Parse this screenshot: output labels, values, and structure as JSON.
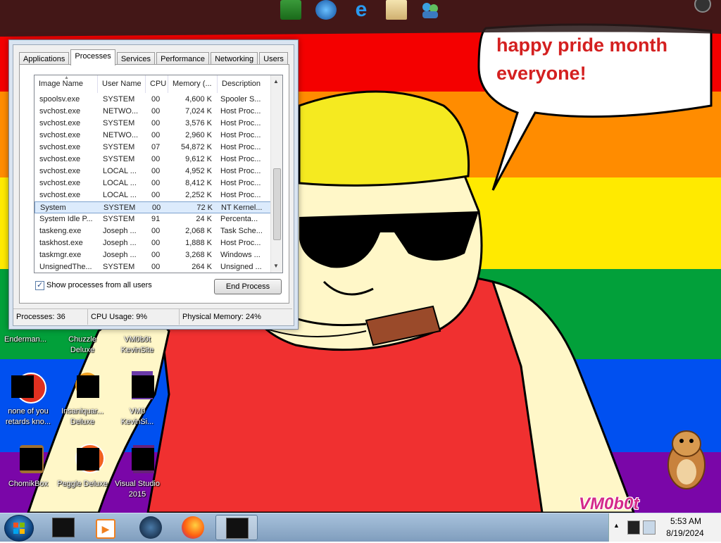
{
  "speech_bubble": {
    "line1": "happy pride month",
    "line2": "everyone!"
  },
  "watermark": "VM0b0t",
  "task_manager": {
    "tabs": [
      "Applications",
      "Processes",
      "Services",
      "Performance",
      "Networking",
      "Users"
    ],
    "active_tab": "Processes",
    "columns": [
      "Image Name",
      "User Name",
      "CPU",
      "Memory (...",
      "Description"
    ],
    "rows": [
      {
        "image": "spoolsv.exe",
        "user": "SYSTEM",
        "cpu": "00",
        "mem": "4,600 K",
        "desc": "Spooler S..."
      },
      {
        "image": "svchost.exe",
        "user": "NETWO...",
        "cpu": "00",
        "mem": "7,024 K",
        "desc": "Host Proc..."
      },
      {
        "image": "svchost.exe",
        "user": "SYSTEM",
        "cpu": "00",
        "mem": "3,576 K",
        "desc": "Host Proc..."
      },
      {
        "image": "svchost.exe",
        "user": "NETWO...",
        "cpu": "00",
        "mem": "2,960 K",
        "desc": "Host Proc..."
      },
      {
        "image": "svchost.exe",
        "user": "SYSTEM",
        "cpu": "07",
        "mem": "54,872 K",
        "desc": "Host Proc..."
      },
      {
        "image": "svchost.exe",
        "user": "SYSTEM",
        "cpu": "00",
        "mem": "9,612 K",
        "desc": "Host Proc..."
      },
      {
        "image": "svchost.exe",
        "user": "LOCAL ...",
        "cpu": "00",
        "mem": "4,952 K",
        "desc": "Host Proc..."
      },
      {
        "image": "svchost.exe",
        "user": "LOCAL ...",
        "cpu": "00",
        "mem": "8,412 K",
        "desc": "Host Proc..."
      },
      {
        "image": "svchost.exe",
        "user": "LOCAL ...",
        "cpu": "00",
        "mem": "2,252 K",
        "desc": "Host Proc..."
      },
      {
        "image": "System",
        "user": "SYSTEM",
        "cpu": "00",
        "mem": "72 K",
        "desc": "NT Kernel..."
      },
      {
        "image": "System Idle P...",
        "user": "SYSTEM",
        "cpu": "91",
        "mem": "24 K",
        "desc": "Percenta..."
      },
      {
        "image": "taskeng.exe",
        "user": "Joseph ...",
        "cpu": "00",
        "mem": "2,068 K",
        "desc": "Task Sche..."
      },
      {
        "image": "taskhost.exe",
        "user": "Joseph ...",
        "cpu": "00",
        "mem": "1,888 K",
        "desc": "Host Proc..."
      },
      {
        "image": "taskmgr.exe",
        "user": "Joseph ...",
        "cpu": "00",
        "mem": "3,268 K",
        "desc": "Windows ..."
      },
      {
        "image": "UnsignedThe...",
        "user": "SYSTEM",
        "cpu": "00",
        "mem": "264 K",
        "desc": "Unsigned ..."
      }
    ],
    "selected_row": "System",
    "show_all_label": "Show processes from all users",
    "end_process_label": "End Process",
    "status": {
      "processes": "Processes: 36",
      "cpu": "CPU Usage: 9%",
      "memory": "Physical Memory: 24%"
    }
  },
  "desktop_icons": [
    {
      "label1": "Enderman...",
      "label2": "",
      "partial": true
    },
    {
      "label1": "Chuzzle",
      "label2": "Deluxe"
    },
    {
      "label1": "VM0b0t",
      "label2": "KevinSite"
    },
    {
      "label1": "none of you",
      "label2": "retards kno..."
    },
    {
      "label1": "Insaniquar...",
      "label2": "Deluxe"
    },
    {
      "label1": "VM0",
      "label2": "KevinSi..."
    },
    {
      "label1": "ChomikBox",
      "label2": ""
    },
    {
      "label1": "Peggle Deluxe",
      "label2": ""
    },
    {
      "label1": "Visual Studio",
      "label2": "2015"
    }
  ],
  "icons": {
    "quick_launch": [
      "excel-icon",
      "network-globe-icon",
      "internet-explorer-icon",
      "mail-icon",
      "users-icon"
    ],
    "taskbar": [
      "start-orb-icon",
      "folder-icon",
      "media-player-icon",
      "globe-icon",
      "firefox-icon",
      "task-manager-icon"
    ]
  },
  "clock": {
    "time": "5:53 AM",
    "date": "8/19/2024"
  },
  "colors": {
    "red": "#f40000",
    "orange": "#ff8c00",
    "yellow": "#ffea00",
    "green": "#02a03a",
    "blue": "#0050f0",
    "purple": "#7a06a8",
    "bubble_text": "#d42020"
  }
}
